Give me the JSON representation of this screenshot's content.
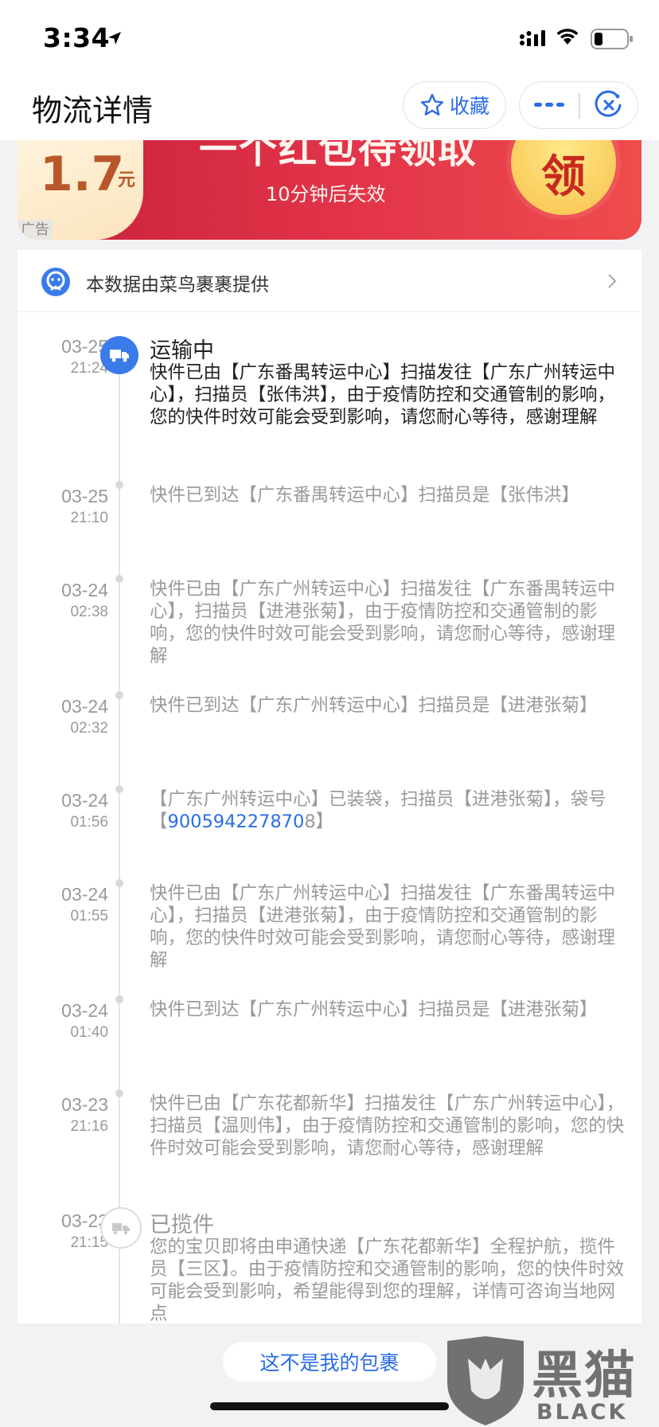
{
  "status_bar": {
    "time": "3:34"
  },
  "nav": {
    "title": "物流详情",
    "favorite_label": "收藏"
  },
  "ad": {
    "amount": "1.7",
    "unit": "元",
    "headline": "一个红包待领取",
    "subtitle": "10分钟后失效",
    "claim_label": "领",
    "tag": "广告"
  },
  "provider": {
    "text": "本数据由菜鸟裹裹提供"
  },
  "timeline": [
    {
      "date": "03-25",
      "time": "21:24",
      "status": "运输中",
      "text": "快件已由【广东番禺转运中心】扫描发往【广东广州转运中心】，扫描员【张伟洪】，由于疫情防控和交通管制的影响，您的快件时效可能会受到影响，请您耐心等待，感谢理解"
    },
    {
      "date": "03-25",
      "time": "21:10",
      "text": "快件已到达【广东番禺转运中心】扫描员是【张伟洪】"
    },
    {
      "date": "03-24",
      "time": "02:38",
      "text": "快件已由【广东广州转运中心】扫描发往【广东番禺转运中心】，扫描员【进港张菊】，由于疫情防控和交通管制的影响，您的快件时效可能会受到影响，请您耐心等待，感谢理解"
    },
    {
      "date": "03-24",
      "time": "02:32",
      "text": "快件已到达【广东广州转运中心】扫描员是【进港张菊】"
    },
    {
      "date": "03-24",
      "time": "01:56",
      "text_before": "【广东广州转运中心】已装袋，扫描员【进港张菊】，袋号【",
      "bag_number": "900594227870",
      "text_after": "8】"
    },
    {
      "date": "03-24",
      "time": "01:55",
      "text": "快件已由【广东广州转运中心】扫描发往【广东番禺转运中心】，扫描员【进港张菊】，由于疫情防控和交通管制的影响，您的快件时效可能会受到影响，请您耐心等待，感谢理解"
    },
    {
      "date": "03-24",
      "time": "01:40",
      "text": "快件已到达【广东广州转运中心】扫描员是【进港张菊】"
    },
    {
      "date": "03-23",
      "time": "21:16",
      "text": "快件已由【广东花都新华】扫描发往【广东广州转运中心】，扫描员【温则伟】，由于疫情防控和交通管制的影响，您的快件时效可能会受到影响，请您耐心等待，感谢理解"
    },
    {
      "date": "03-23",
      "time": "21:15",
      "status": "已揽件",
      "text": "您的宝贝即将由申通快递【广东花都新华】全程护航，揽件员【三区】。由于疫情防控和交通管制的影响，您的快件时效可能会受到影响，希望能得到您的理解，详情可咨询当地网点"
    }
  ],
  "bottom": {
    "not_mine_label": "这不是我的包裹"
  },
  "watermark": {
    "cn": "黑猫",
    "en": "BLACK CAT"
  },
  "colors": {
    "accent": "#2a6de8",
    "active_dot": "#3a7bea",
    "ad_red": "#e2354a"
  }
}
